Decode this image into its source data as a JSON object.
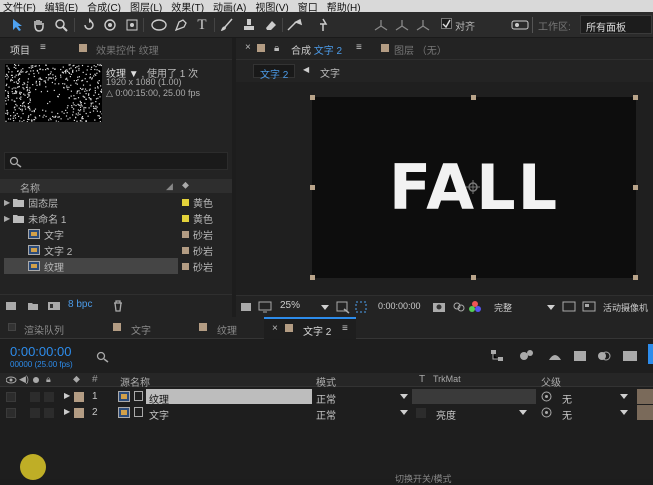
{
  "menu": [
    "文件(F)",
    "编辑(E)",
    "合成(C)",
    "图层(L)",
    "效果(T)",
    "动画(A)",
    "视图(V)",
    "窗口",
    "帮助(H)"
  ],
  "toolbar": {
    "snap_label": "对齐",
    "workspace_label": "工作区:",
    "workspace_value": "所有面板"
  },
  "project_panel": {
    "tab_project": "项目",
    "tab_effects": "效果控件 纹理",
    "item_name": "纹理",
    "item_used": ", 使用了 1 次",
    "item_size": "1920 x 1080 (1.00)",
    "item_duration": "△ 0:00:15:00, 25.00 fps",
    "search_placeholder": "",
    "col_name": "名称",
    "items": [
      {
        "label": "固态层",
        "tag": "黄色",
        "color": "#e3d23a"
      },
      {
        "label": "未命名 1",
        "tag": "黄色",
        "color": "#e3d23a"
      },
      {
        "label": "文字",
        "tag": "砂岩",
        "color": "#b39c83"
      },
      {
        "label": "文字 2",
        "tag": "砂岩",
        "color": "#b39c83"
      },
      {
        "label": "纹理",
        "tag": "砂岩",
        "color": "#b39c83"
      }
    ],
    "bpc": "8 bpc"
  },
  "comp_panel": {
    "tab_comp": "合成",
    "tab_comp_name": "文字 2",
    "tab_layer": "图层 （无）",
    "crumb1": "文字 2",
    "crumb2": "文字",
    "canvas_text": "FALL",
    "zoom": "25%",
    "timecode": "0:00:00:00",
    "quality": "完整",
    "camera": "活动摄像机"
  },
  "timeline_tabs": [
    "渲染队列",
    "文字",
    "纹理",
    "文字 2"
  ],
  "timeline": {
    "timecode": "0:00:00:00",
    "frames": "00000 (25.00 fps)",
    "col_hash": "#",
    "col_source": "源名称",
    "col_mode": "模式",
    "col_t": "T",
    "col_trkmat": "TrkMat",
    "col_parent": "父级",
    "layers": [
      {
        "num": "1",
        "name": "纹理",
        "mode": "正常",
        "trkmat": "",
        "parent": "无"
      },
      {
        "num": "2",
        "name": "文字",
        "mode": "正常",
        "trkmat": "亮度",
        "parent": "无"
      }
    ],
    "footer": "切换开关/模式"
  },
  "colors": {
    "accent_blue": "#2d8ceb",
    "sand": "#b39c83",
    "yellow": "#e3d23a"
  }
}
